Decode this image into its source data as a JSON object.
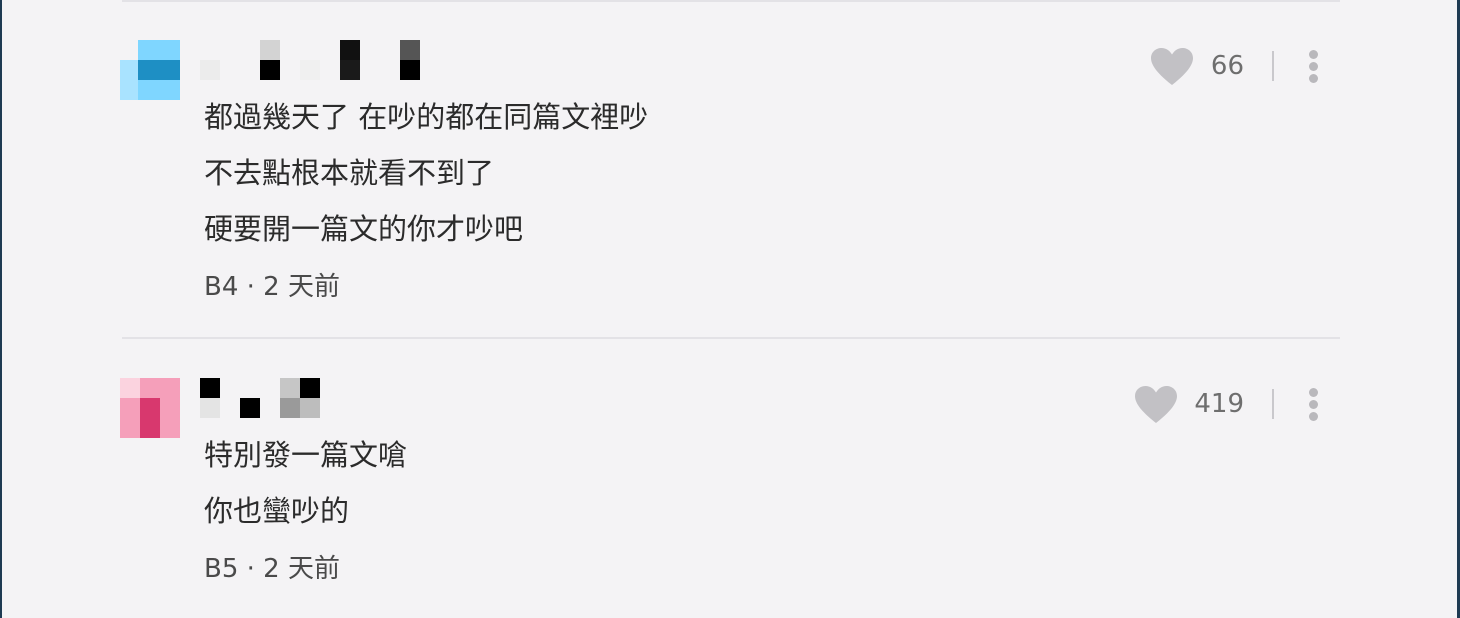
{
  "comments": [
    {
      "floor_time": "B4 · 2 天前",
      "text_lines": [
        "都過幾天了 在吵的都在同篇文裡吵",
        "不去點根本就看不到了",
        "硬要開一篇文的你才吵吧"
      ],
      "like_count": "66",
      "avatar_colors": [
        "#7fd6ff",
        "#1e8fc4",
        "#a9e3ff"
      ]
    },
    {
      "floor_time": "B5 · 2 天前",
      "text_lines": [
        "特別發一篇文嗆",
        "你也蠻吵的"
      ],
      "like_count": "419",
      "avatar_colors": [
        "#f59fba",
        "#d8386e",
        "#fbd3df"
      ]
    }
  ],
  "icons": {
    "like": "heart-icon",
    "more": "more-vertical-icon"
  },
  "colors": {
    "background": "#f4f3f5",
    "divider": "#e3e2e6",
    "icon": "#c2c1c5"
  }
}
